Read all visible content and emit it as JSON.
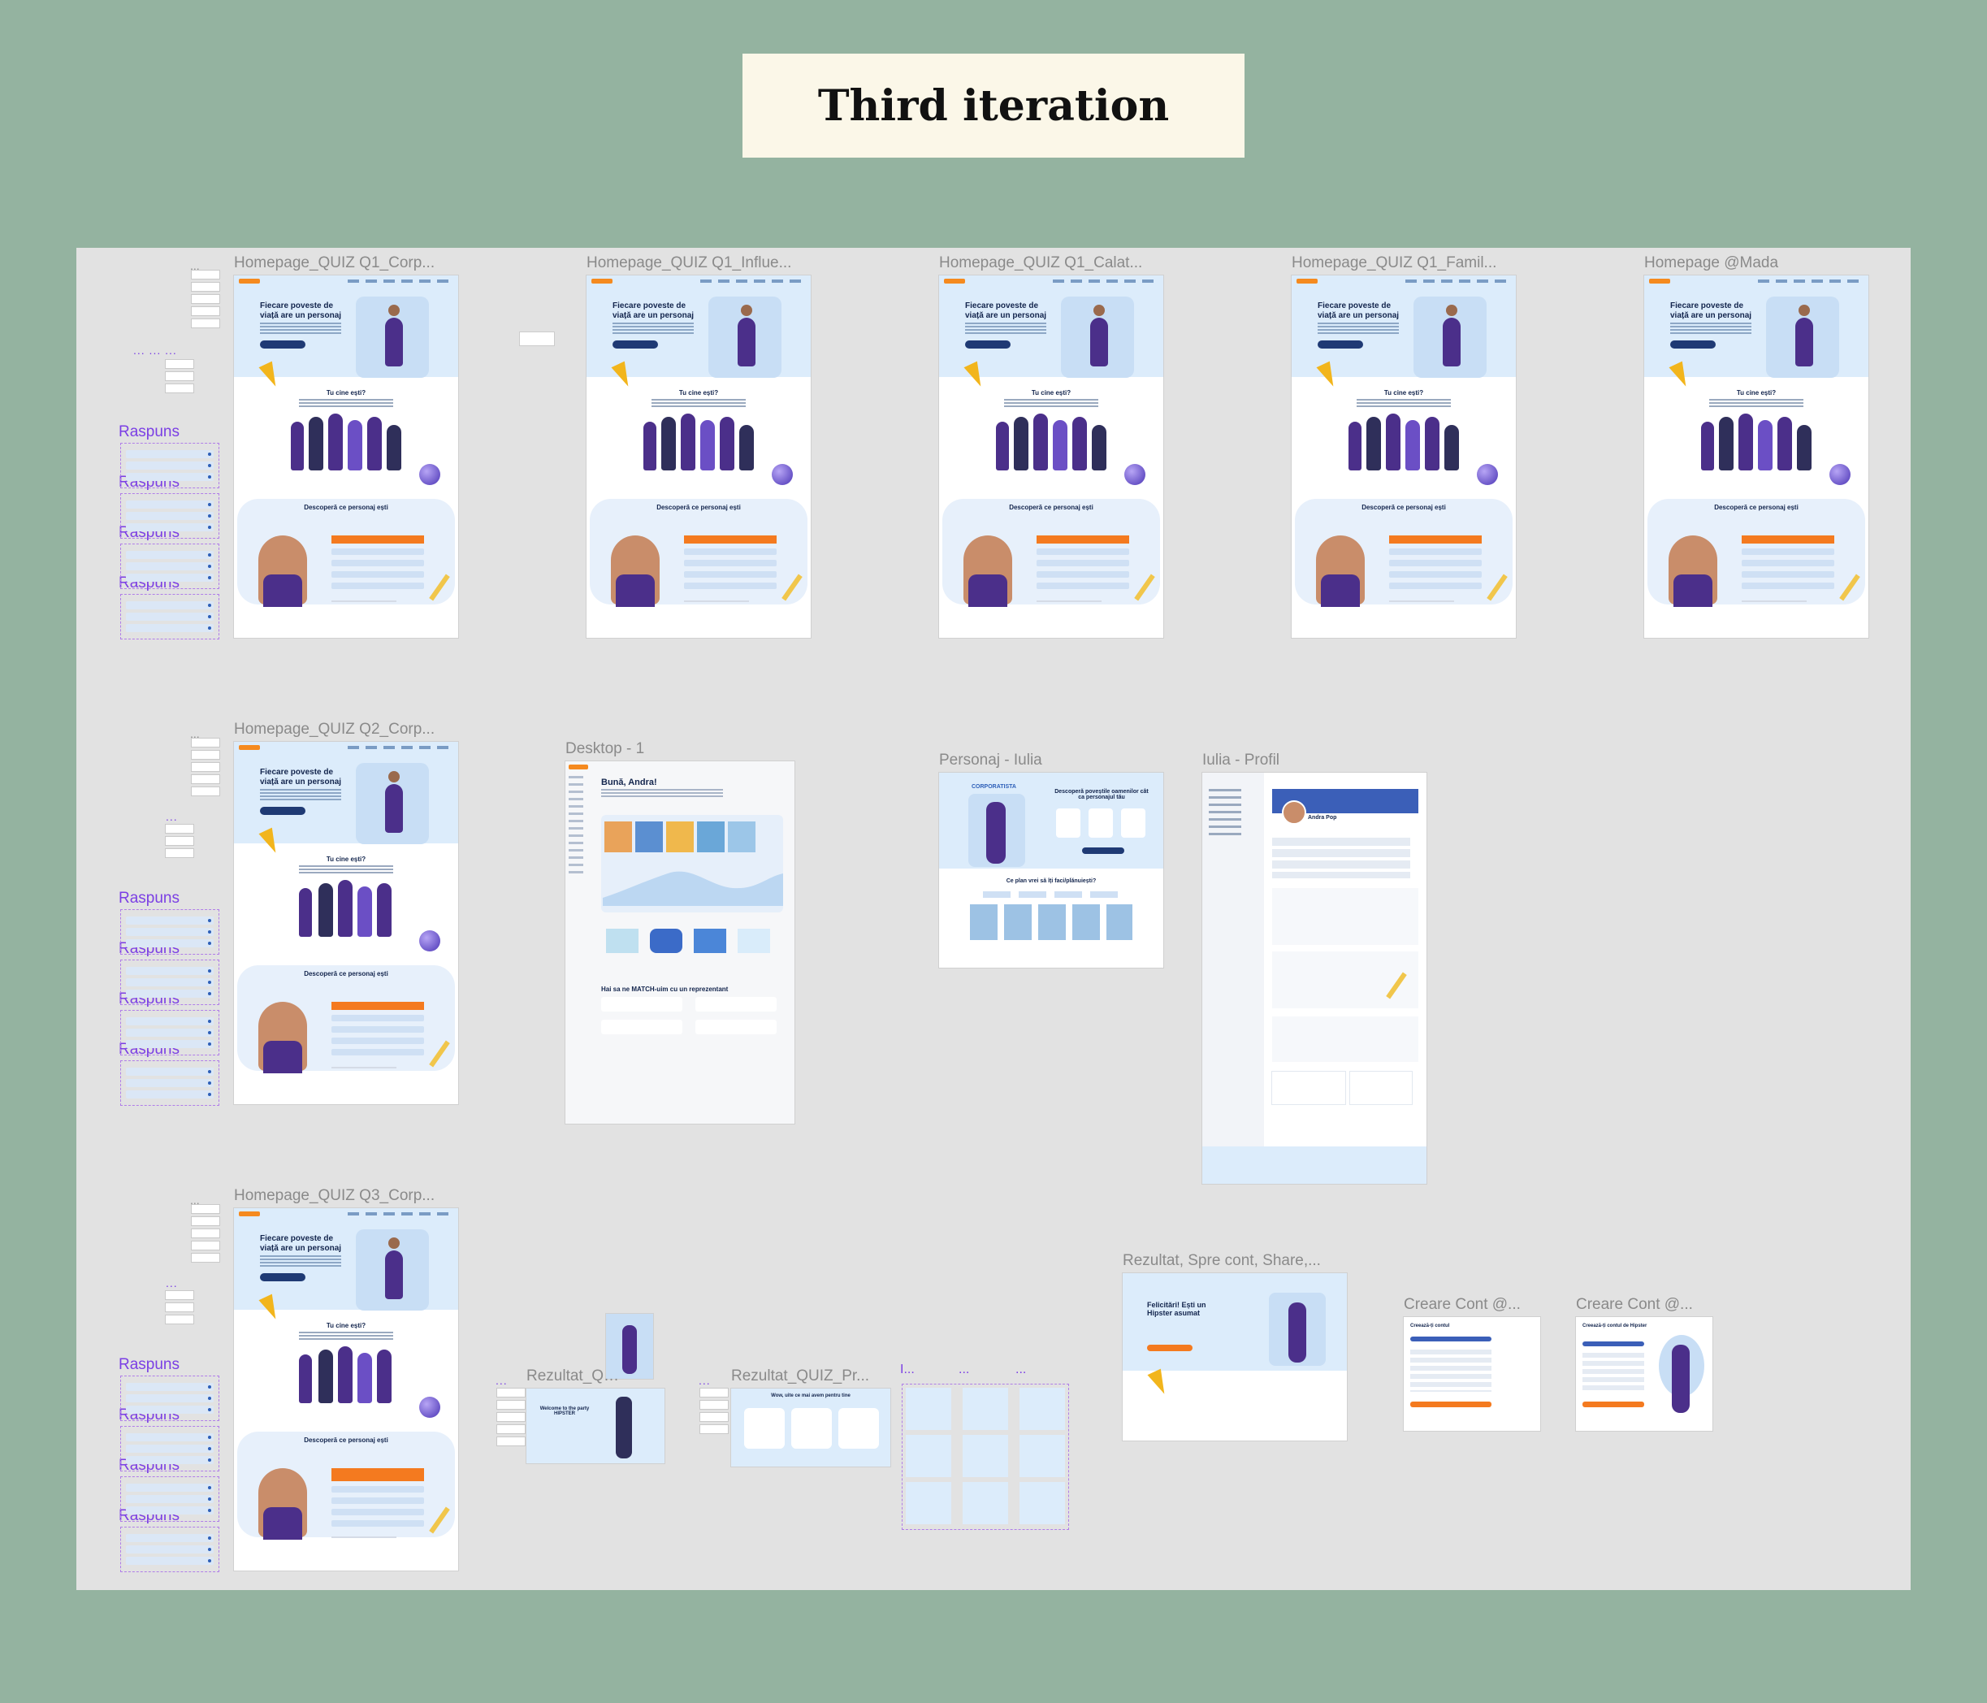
{
  "board_title": "Third iteration",
  "frames": {
    "hp_q1_corp": "Homepage_QUIZ Q1_Corp...",
    "hp_q1_influe": "Homepage_QUIZ Q1_Influe...",
    "hp_q1_calat": "Homepage_QUIZ Q1_Calat...",
    "hp_q1_famil": "Homepage_QUIZ Q1_Famil...",
    "hp_mada": "Homepage @Mada",
    "hp_q2_corp": "Homepage_QUIZ Q2_Corp...",
    "desktop_1": "Desktop - 1",
    "personaj_iulia": "Personaj - Iulia",
    "iulia_profil": "Iulia - Profil",
    "hp_q3_corp": "Homepage_QUIZ Q3_Corp...",
    "rezultat_spre_cont": "Rezultat, Spre cont, Share,...",
    "creare_cont_1": "Creare Cont @...",
    "creare_cont_2": "Creare Cont @...",
    "rezultat_qui": "Rezultat_QUI...",
    "rezultat_quiz_pr": "Rezultat_QUIZ_Pr...",
    "comp_1": "I...",
    "comp_2": "...",
    "comp_3": "..."
  },
  "variant_label": "Raspuns",
  "homepage": {
    "hero_title": "Fiecare poveste de viață are un personaj",
    "section_who": "Tu cine ești?",
    "section_discover": "Descoperă ce personaj ești"
  },
  "desktop": {
    "greeting": "Bună, Andra!",
    "match_title": "Hai sa ne MATCH-uim cu un reprezentant"
  },
  "personaj": {
    "badge": "CORPORATISTA",
    "title": "Descoperă poveștile oamenilor cât ca personajul tău",
    "plan_title": "Ce plan vrei să îți faci/plănuiești?"
  },
  "profil": {
    "name": "Andra Pop"
  },
  "rezultat": {
    "title": "Felicitări! Ești un Hipster asumat"
  },
  "creare_cont": {
    "title_1": "Creează-ți contul",
    "title_2": "Creează-ți contul de Hipster"
  },
  "rezultat_qui_text": "Welcome to the party HIPSTER",
  "rezultat_pr_text": "Wow, uite ce mai avem pentru tine"
}
